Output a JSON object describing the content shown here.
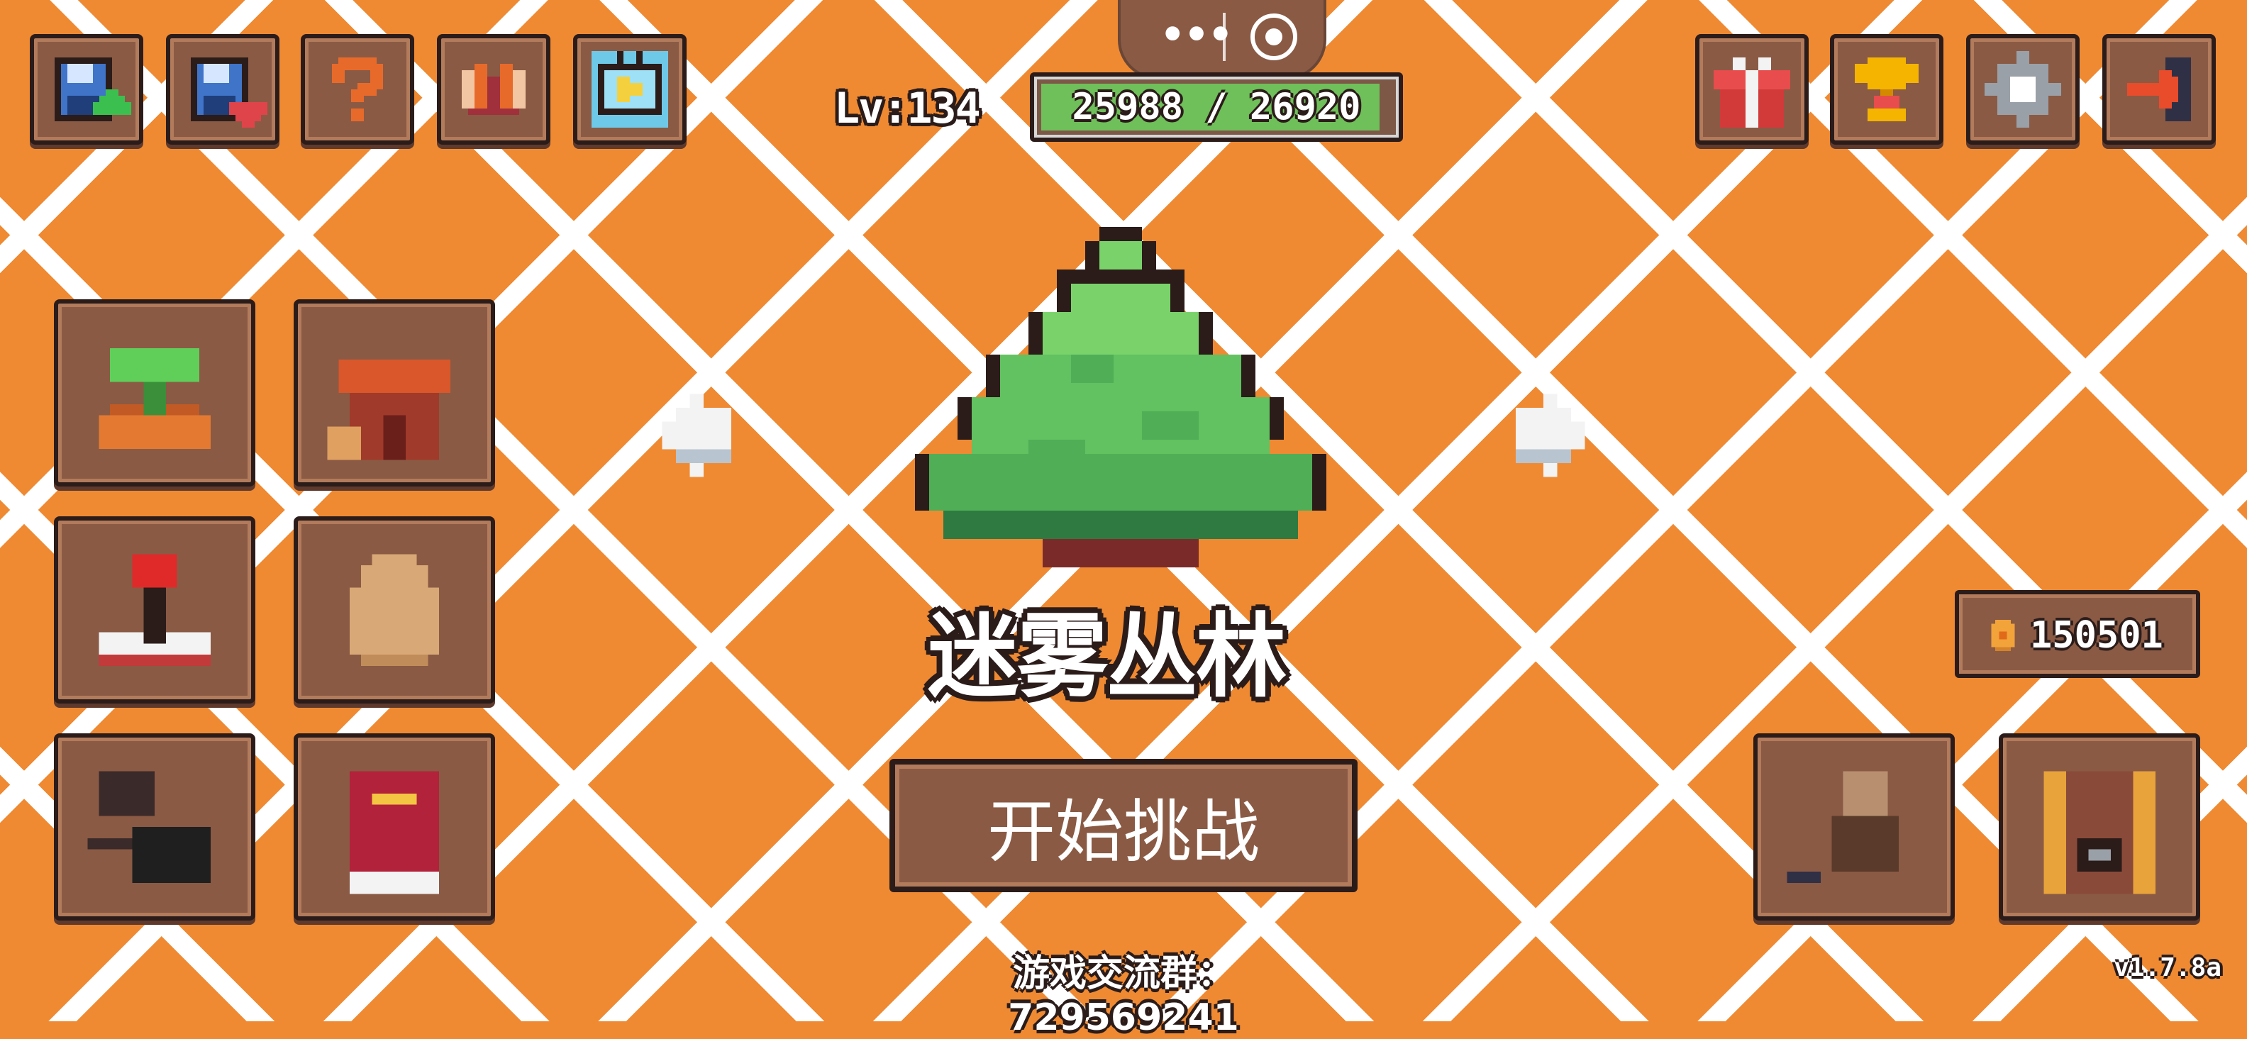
{
  "level": {
    "text": "Lv:134"
  },
  "xp": {
    "text": "25988 / 26920",
    "current": 25988,
    "max": 26920
  },
  "capsule": {
    "menu_icon": "more-dots-icon",
    "close_icon": "target-circle-icon"
  },
  "top_left_buttons": [
    {
      "icon": "save-upload-icon"
    },
    {
      "icon": "save-download-icon"
    },
    {
      "icon": "help-question-icon"
    },
    {
      "icon": "wings-icon"
    },
    {
      "icon": "video-play-icon"
    }
  ],
  "top_right_buttons": [
    {
      "icon": "gift-box-icon"
    },
    {
      "icon": "trophy-icon"
    },
    {
      "icon": "settings-gear-icon"
    },
    {
      "icon": "exit-arrow-icon"
    }
  ],
  "left_grid": [
    {
      "icon": "farm-sprout-icon"
    },
    {
      "icon": "house-shop-icon"
    },
    {
      "icon": "arcade-joystick-icon"
    },
    {
      "icon": "egg-icon"
    },
    {
      "icon": "frying-pan-icon"
    },
    {
      "icon": "red-book-icon"
    }
  ],
  "stage": {
    "name": "迷雾丛林",
    "icon": "pine-tree-icon"
  },
  "start_button": {
    "label": "开始挑战"
  },
  "coins": {
    "value": "150501",
    "icon": "coin-icon"
  },
  "bottom_right_buttons": [
    {
      "icon": "blacksmith-anvil-icon"
    },
    {
      "icon": "treasure-chest-icon"
    }
  ],
  "community": {
    "text": "游戏交流群：729569241"
  },
  "version": {
    "text": "v1.7.8a"
  },
  "colors": {
    "background": "#ef8a33",
    "panel": "#8a5a44",
    "outline": "#2b1c1a",
    "xp_green": "#6fbf5a"
  }
}
